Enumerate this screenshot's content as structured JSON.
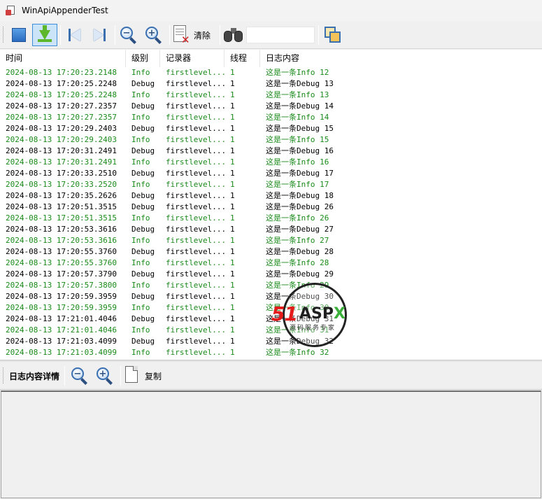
{
  "window": {
    "title": "WinApiAppenderTest"
  },
  "toolbar": {
    "clear_label": "清除",
    "search_value": "",
    "search_placeholder": ""
  },
  "grid": {
    "columns": [
      "时间",
      "级别",
      "记录器",
      "线程",
      "日志内容"
    ],
    "rows": [
      {
        "time": "2024-08-13 17:20:23.2148",
        "level": "Info",
        "logger": "firstlevel...",
        "thread": "1",
        "message": "这是一条Info 12"
      },
      {
        "time": "2024-08-13 17:20:25.2248",
        "level": "Debug",
        "logger": "firstlevel...",
        "thread": "1",
        "message": "这是一条Debug 13"
      },
      {
        "time": "2024-08-13 17:20:25.2248",
        "level": "Info",
        "logger": "firstlevel...",
        "thread": "1",
        "message": "这是一条Info 13"
      },
      {
        "time": "2024-08-13 17:20:27.2357",
        "level": "Debug",
        "logger": "firstlevel...",
        "thread": "1",
        "message": "这是一条Debug 14"
      },
      {
        "time": "2024-08-13 17:20:27.2357",
        "level": "Info",
        "logger": "firstlevel...",
        "thread": "1",
        "message": "这是一条Info 14"
      },
      {
        "time": "2024-08-13 17:20:29.2403",
        "level": "Debug",
        "logger": "firstlevel...",
        "thread": "1",
        "message": "这是一条Debug 15"
      },
      {
        "time": "2024-08-13 17:20:29.2403",
        "level": "Info",
        "logger": "firstlevel...",
        "thread": "1",
        "message": "这是一条Info 15"
      },
      {
        "time": "2024-08-13 17:20:31.2491",
        "level": "Debug",
        "logger": "firstlevel...",
        "thread": "1",
        "message": "这是一条Debug 16"
      },
      {
        "time": "2024-08-13 17:20:31.2491",
        "level": "Info",
        "logger": "firstlevel...",
        "thread": "1",
        "message": "这是一条Info 16"
      },
      {
        "time": "2024-08-13 17:20:33.2510",
        "level": "Debug",
        "logger": "firstlevel...",
        "thread": "1",
        "message": "这是一条Debug 17"
      },
      {
        "time": "2024-08-13 17:20:33.2520",
        "level": "Info",
        "logger": "firstlevel...",
        "thread": "1",
        "message": "这是一条Info 17"
      },
      {
        "time": "2024-08-13 17:20:35.2626",
        "level": "Debug",
        "logger": "firstlevel...",
        "thread": "1",
        "message": "这是一条Debug 18"
      },
      {
        "time": "2024-08-13 17:20:51.3515",
        "level": "Debug",
        "logger": "firstlevel...",
        "thread": "1",
        "message": "这是一条Debug 26"
      },
      {
        "time": "2024-08-13 17:20:51.3515",
        "level": "Info",
        "logger": "firstlevel...",
        "thread": "1",
        "message": "这是一条Info 26"
      },
      {
        "time": "2024-08-13 17:20:53.3616",
        "level": "Debug",
        "logger": "firstlevel...",
        "thread": "1",
        "message": "这是一条Debug 27"
      },
      {
        "time": "2024-08-13 17:20:53.3616",
        "level": "Info",
        "logger": "firstlevel...",
        "thread": "1",
        "message": "这是一条Info 27"
      },
      {
        "time": "2024-08-13 17:20:55.3760",
        "level": "Debug",
        "logger": "firstlevel...",
        "thread": "1",
        "message": "这是一条Debug 28"
      },
      {
        "time": "2024-08-13 17:20:55.3760",
        "level": "Info",
        "logger": "firstlevel...",
        "thread": "1",
        "message": "这是一条Info 28"
      },
      {
        "time": "2024-08-13 17:20:57.3790",
        "level": "Debug",
        "logger": "firstlevel...",
        "thread": "1",
        "message": "这是一条Debug 29"
      },
      {
        "time": "2024-08-13 17:20:57.3800",
        "level": "Info",
        "logger": "firstlevel...",
        "thread": "1",
        "message": "这是一条Info 29"
      },
      {
        "time": "2024-08-13 17:20:59.3959",
        "level": "Debug",
        "logger": "firstlevel...",
        "thread": "1",
        "message": "这是一条Debug 30"
      },
      {
        "time": "2024-08-13 17:20:59.3959",
        "level": "Info",
        "logger": "firstlevel...",
        "thread": "1",
        "message": "这是一条Info 30"
      },
      {
        "time": "2024-08-13 17:21:01.4046",
        "level": "Debug",
        "logger": "firstlevel...",
        "thread": "1",
        "message": "这是一条Debug 31"
      },
      {
        "time": "2024-08-13 17:21:01.4046",
        "level": "Info",
        "logger": "firstlevel...",
        "thread": "1",
        "message": "这是一条Info 31"
      },
      {
        "time": "2024-08-13 17:21:03.4099",
        "level": "Debug",
        "logger": "firstlevel...",
        "thread": "1",
        "message": "这是一条Debug 32"
      },
      {
        "time": "2024-08-13 17:21:03.4099",
        "level": "Info",
        "logger": "firstlevel...",
        "thread": "1",
        "message": "这是一条Info 32"
      }
    ]
  },
  "detail": {
    "title": "日志内容详情",
    "copy_label": "复制",
    "content": ""
  },
  "watermark": {
    "brand_a": "51",
    "brand_b": "ASP",
    "brand_c": "X",
    "subtitle": "源码服务专家"
  },
  "colors": {
    "info": "#1a8a1a",
    "debug": "#000000",
    "accent": "#3a8edc"
  },
  "icons": {
    "title": "app-icon",
    "toolbar": [
      "stop-icon",
      "autoscroll-icon",
      "first-icon",
      "last-icon",
      "zoom-out-icon",
      "zoom-in-icon",
      "clear-icon",
      "find-icon",
      "copy-window-icon"
    ],
    "detail_toolbar": [
      "zoom-out-icon",
      "zoom-in-icon",
      "copy-icon"
    ]
  }
}
